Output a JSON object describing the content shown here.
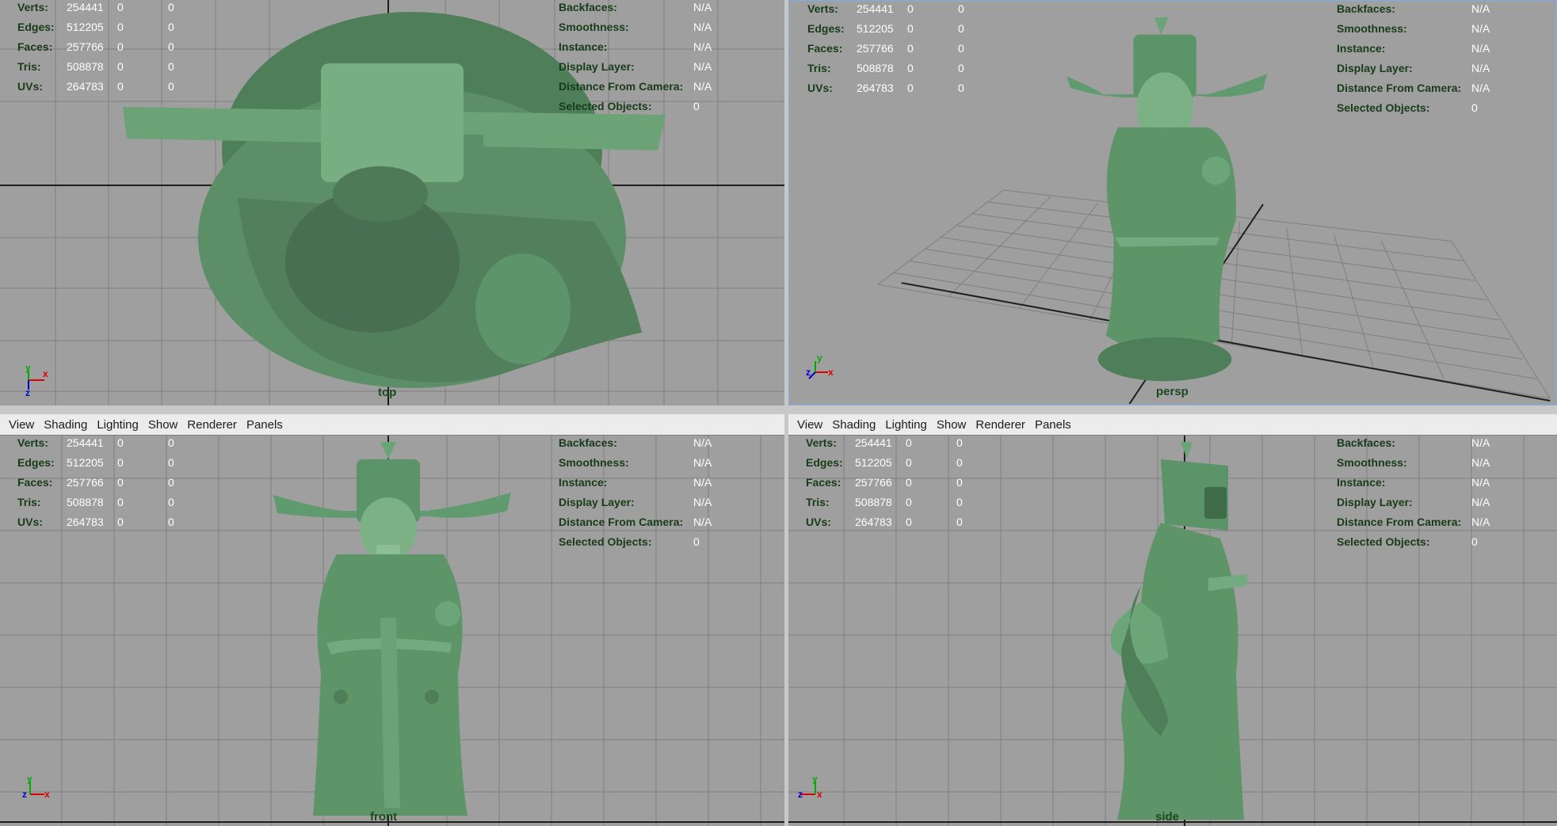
{
  "menu": [
    "View",
    "Shading",
    "Lighting",
    "Show",
    "Renderer",
    "Panels"
  ],
  "hud_stats": [
    {
      "label": "Verts:",
      "v1": "254441",
      "v2": "0",
      "v3": "0"
    },
    {
      "label": "Edges:",
      "v1": "512205",
      "v2": "0",
      "v3": "0"
    },
    {
      "label": "Faces:",
      "v1": "257766",
      "v2": "0",
      "v3": "0"
    },
    {
      "label": "Tris:",
      "v1": "508878",
      "v2": "0",
      "v3": "0"
    },
    {
      "label": "UVs:",
      "v1": "264783",
      "v2": "0",
      "v3": "0"
    }
  ],
  "hud_info": [
    {
      "label": "Backfaces:",
      "value": "N/A"
    },
    {
      "label": "Smoothness:",
      "value": "N/A"
    },
    {
      "label": "Instance:",
      "value": "N/A"
    },
    {
      "label": "Display Layer:",
      "value": "N/A"
    },
    {
      "label": "Distance From Camera:",
      "value": "N/A"
    },
    {
      "label": "Selected Objects:",
      "value": "0"
    }
  ],
  "viewports": {
    "top": {
      "camera": "top"
    },
    "persp": {
      "camera": "persp"
    },
    "front": {
      "camera": "front"
    },
    "side": {
      "camera": "side"
    }
  },
  "colors": {
    "viewport_bg": "#9f9f9f",
    "grid": "#7d7d7d",
    "model_green": "#5f9b6f",
    "hud_label": "#173c17",
    "hud_value": "#ffffff",
    "active_border": "#8ea7c4"
  },
  "icons": {
    "axis_gizmo": "axis-gizmo-icon"
  }
}
